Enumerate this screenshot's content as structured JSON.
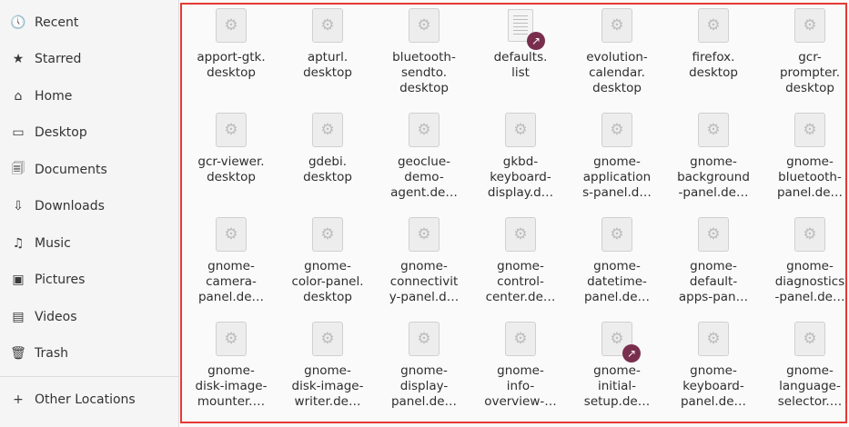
{
  "sidebar": {
    "items": [
      {
        "label": "Recent",
        "icon": "clock-icon",
        "glyph": "🕔"
      },
      {
        "label": "Starred",
        "icon": "star-icon",
        "glyph": "★"
      },
      {
        "label": "Home",
        "icon": "home-icon",
        "glyph": "⌂"
      },
      {
        "label": "Desktop",
        "icon": "desktop-icon",
        "glyph": "▭"
      },
      {
        "label": "Documents",
        "icon": "document-icon",
        "glyph": "🗐"
      },
      {
        "label": "Downloads",
        "icon": "download-icon",
        "glyph": "⇩"
      },
      {
        "label": "Music",
        "icon": "music-icon",
        "glyph": "♫"
      },
      {
        "label": "Pictures",
        "icon": "picture-icon",
        "glyph": "▣"
      },
      {
        "label": "Videos",
        "icon": "video-icon",
        "glyph": "▤"
      },
      {
        "label": "Trash",
        "icon": "trash-icon",
        "glyph": "🗑"
      }
    ],
    "other_locations": {
      "label": "Other Locations",
      "icon": "plus-icon",
      "glyph": "+"
    }
  },
  "files": [
    {
      "name": "apport-gtk.\ndesktop",
      "type": "gear",
      "link": false
    },
    {
      "name": "apturl.\ndesktop",
      "type": "gear",
      "link": false
    },
    {
      "name": "bluetooth-\nsendto.\ndesktop",
      "type": "gear",
      "link": false
    },
    {
      "name": "defaults.\nlist",
      "type": "doc",
      "link": true
    },
    {
      "name": "evolution-\ncalendar.\ndesktop",
      "type": "gear",
      "link": false
    },
    {
      "name": "firefox.\ndesktop",
      "type": "gear",
      "link": false
    },
    {
      "name": "gcr-\nprompter.\ndesktop",
      "type": "gear",
      "link": false
    },
    {
      "name": "gcr-viewer.\ndesktop",
      "type": "gear",
      "link": false
    },
    {
      "name": "gdebi.\ndesktop",
      "type": "gear",
      "link": false
    },
    {
      "name": "geoclue-\ndemo-\nagent.de…",
      "type": "gear",
      "link": false
    },
    {
      "name": "gkbd-\nkeyboard-\ndisplay.d…",
      "type": "gear",
      "link": false
    },
    {
      "name": "gnome-\napplication\ns-panel.d…",
      "type": "gear",
      "link": false
    },
    {
      "name": "gnome-\nbackground\n-panel.de…",
      "type": "gear",
      "link": false
    },
    {
      "name": "gnome-\nbluetooth-\npanel.de…",
      "type": "gear",
      "link": false
    },
    {
      "name": "gnome-\ncamera-\npanel.de…",
      "type": "gear",
      "link": false
    },
    {
      "name": "gnome-\ncolor-panel.\ndesktop",
      "type": "gear",
      "link": false
    },
    {
      "name": "gnome-\nconnectivit\ny-panel.d…",
      "type": "gear",
      "link": false
    },
    {
      "name": "gnome-\ncontrol-\ncenter.de…",
      "type": "gear",
      "link": false
    },
    {
      "name": "gnome-\ndatetime-\npanel.de…",
      "type": "gear",
      "link": false
    },
    {
      "name": "gnome-\ndefault-\napps-pan…",
      "type": "gear",
      "link": false
    },
    {
      "name": "gnome-\ndiagnostics\n-panel.de…",
      "type": "gear",
      "link": false
    },
    {
      "name": "gnome-\ndisk-image-\nmounter.…",
      "type": "gear",
      "link": false
    },
    {
      "name": "gnome-\ndisk-image-\nwriter.de…",
      "type": "gear",
      "link": false
    },
    {
      "name": "gnome-\ndisplay-\npanel.de…",
      "type": "gear",
      "link": false
    },
    {
      "name": "gnome-\ninfo-\noverview-…",
      "type": "gear",
      "link": false
    },
    {
      "name": "gnome-\ninitial-\nsetup.de…",
      "type": "gear",
      "link": true
    },
    {
      "name": "gnome-\nkeyboard-\npanel.de…",
      "type": "gear",
      "link": false
    },
    {
      "name": "gnome-\nlanguage-\nselector.…",
      "type": "gear",
      "link": false
    }
  ],
  "colors": {
    "selection_border": "#e53935",
    "link_badge": "#7a2e4e"
  }
}
